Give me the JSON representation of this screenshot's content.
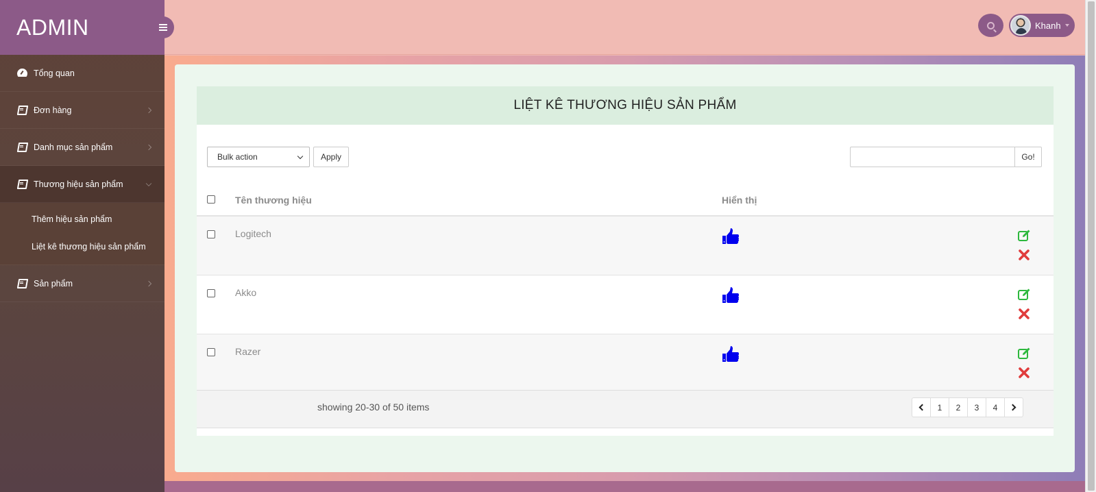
{
  "brand": {
    "title": "ADMIN"
  },
  "header": {
    "user_name": "Khanh"
  },
  "sidebar": {
    "items": [
      {
        "label": "Tổng quan",
        "icon": "dashboard-icon"
      },
      {
        "label": "Đơn hàng",
        "icon": "book-icon"
      },
      {
        "label": "Danh mục sản phẩm",
        "icon": "book-icon"
      },
      {
        "label": "Thương hiệu sản phẩm",
        "icon": "book-icon"
      },
      {
        "label": "Sản phẩm",
        "icon": "book-icon"
      }
    ],
    "submenu": [
      {
        "label": "Thêm hiệu sản phẩm"
      },
      {
        "label": "Liệt kê thương hiệu sản phẩm"
      }
    ]
  },
  "panel": {
    "title": "LIỆT KÊ THƯƠNG HIỆU SẢN PHẨM",
    "bulk_action": "Bulk action",
    "apply_label": "Apply",
    "go_label": "Go!",
    "search_value": ""
  },
  "table": {
    "columns": [
      "Tên thương hiệu",
      "Hiển thị"
    ],
    "rows": [
      {
        "name": "Logitech",
        "status": "thumbs-up-icon"
      },
      {
        "name": "Akko",
        "status": "thumbs-up-icon"
      },
      {
        "name": "Razer",
        "status": "thumbs-up-icon"
      }
    ]
  },
  "footer": {
    "showing": "showing 20-30 of 50 items",
    "pages": [
      "1",
      "2",
      "3",
      "4"
    ]
  },
  "colors": {
    "sidebar": "#5e4238",
    "accent": "#8c5a88",
    "thumb": "#0000ee",
    "edit": "#2db83d",
    "delete": "#e03c3c"
  }
}
